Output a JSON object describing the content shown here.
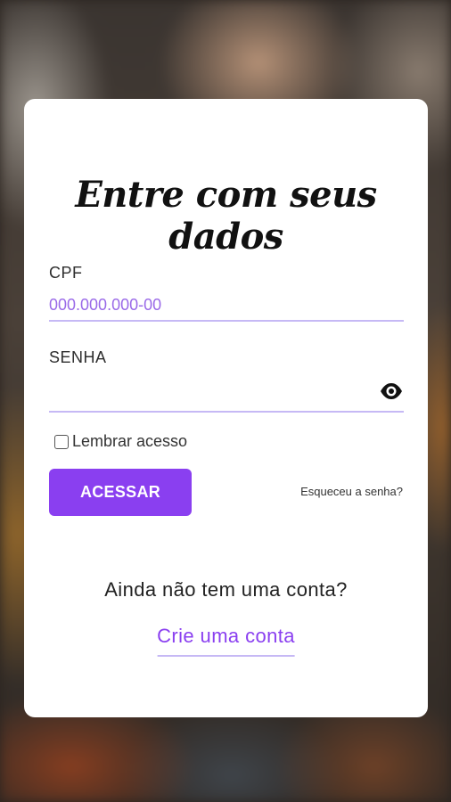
{
  "login": {
    "title": "Entre com seus dados",
    "cpf_label": "CPF",
    "cpf_placeholder": "000.000.000-00",
    "senha_label": "SENHA",
    "senha_value": "",
    "remember_label": "Lembrar acesso",
    "remember_checked": false,
    "submit_label": "ACESSAR",
    "forgot_label": "Esqueceu a senha?",
    "no_account_text": "Ainda não tem uma conta?",
    "create_account_label": "Crie uma conta"
  },
  "colors": {
    "accent": "#8a3ff0",
    "placeholder": "#9a6ae8",
    "underline": "#c6b9f5",
    "card": "#ffffff"
  },
  "icons": {
    "password_toggle": "eye-icon"
  }
}
